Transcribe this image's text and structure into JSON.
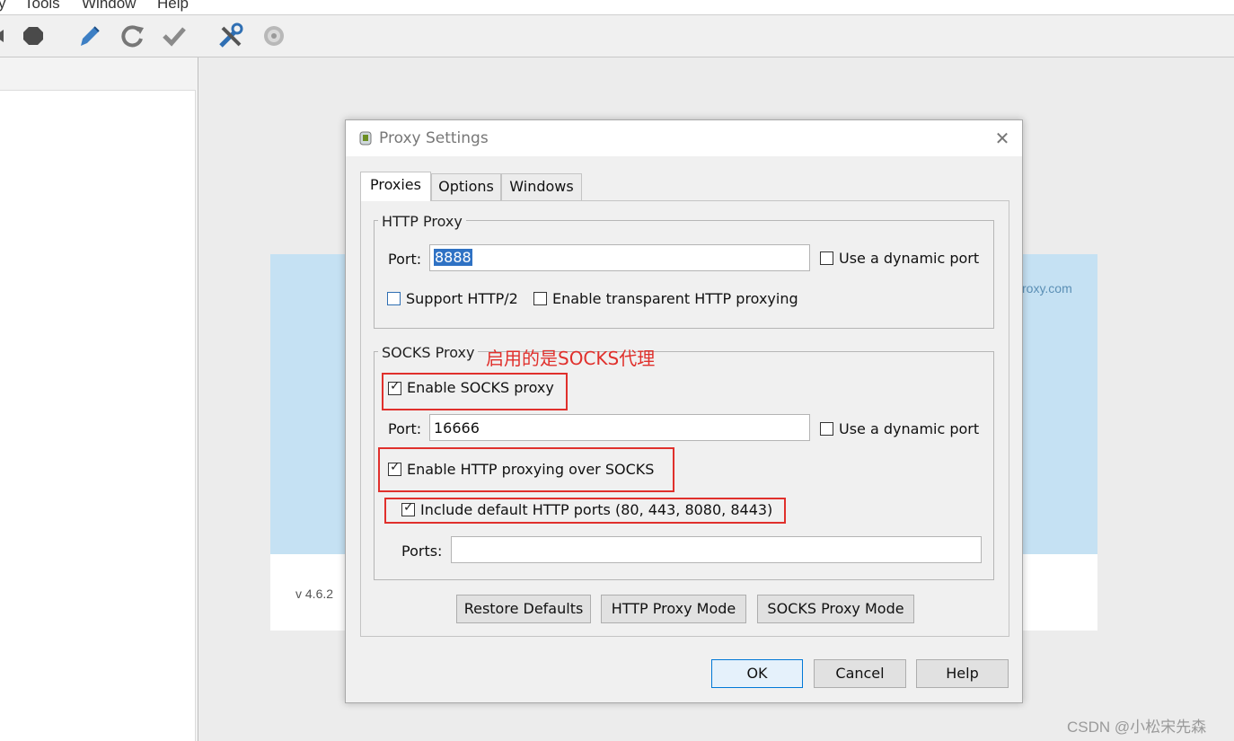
{
  "menu": [
    "y",
    "Tools",
    "Window",
    "Help"
  ],
  "toolbar": {
    "icons": [
      "stop-icon",
      "edit-icon",
      "refresh-icon",
      "check-icon",
      "tools-icon",
      "settings-icon"
    ]
  },
  "background": {
    "splash_url_fragment": "roxy.com",
    "version": "v 4.6.2"
  },
  "dialog": {
    "title": "Proxy Settings",
    "close": "✕",
    "tabs": [
      {
        "label": "Proxies",
        "active": true
      },
      {
        "label": "Options",
        "active": false
      },
      {
        "label": "Windows",
        "active": false
      }
    ],
    "http_proxy": {
      "group_title": "HTTP Proxy",
      "port_label": "Port:",
      "port_value": "8888",
      "dynamic_port_label": "Use a dynamic port",
      "dynamic_port_checked": false,
      "http2_label": "Support HTTP/2",
      "http2_checked": false,
      "transparent_label": "Enable transparent HTTP proxying",
      "transparent_checked": false
    },
    "socks_proxy": {
      "group_title": "SOCKS Proxy",
      "enable_label": "Enable SOCKS proxy",
      "enable_checked": true,
      "port_label": "Port:",
      "port_value": "16666",
      "dynamic_port_label": "Use a dynamic port",
      "dynamic_port_checked": false,
      "http_over_socks_label": "Enable HTTP proxying over SOCKS",
      "http_over_socks_checked": true,
      "default_ports_label": "Include default HTTP ports (80, 443, 8080, 8443)",
      "default_ports_checked": true,
      "ports_label": "Ports:",
      "ports_value": ""
    },
    "annotation": "启用的是SOCKS代理",
    "mode_buttons": {
      "restore": "Restore Defaults",
      "http_mode": "HTTP Proxy Mode",
      "socks_mode": "SOCKS Proxy Mode"
    },
    "footer_buttons": {
      "ok": "OK",
      "cancel": "Cancel",
      "help": "Help"
    }
  },
  "watermark": "CSDN @小松宋先森",
  "colors": {
    "annotation_red": "#e0302c",
    "selection_blue": "#2f72c4",
    "splash_blue": "#c5e1f3"
  }
}
